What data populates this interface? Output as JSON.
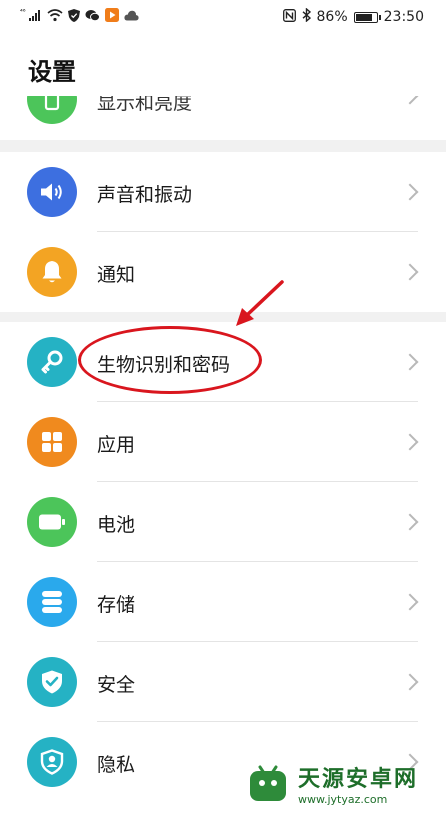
{
  "status_bar": {
    "signal_label": "⁴⁶",
    "battery_percent": "86%",
    "battery_level": 0.86,
    "time": "23:50"
  },
  "page": {
    "title": "设置"
  },
  "partial_item": {
    "label": "显示和亮度",
    "color": "#4cc55a"
  },
  "groups": [
    {
      "items": [
        {
          "label": "声音和振动",
          "icon": "speaker-icon",
          "color": "#3d6fe0"
        },
        {
          "label": "通知",
          "icon": "bell-icon",
          "color": "#f3a423"
        }
      ]
    },
    {
      "items": [
        {
          "label": "生物识别和密码",
          "icon": "key-icon",
          "color": "#25b2c4"
        },
        {
          "label": "应用",
          "icon": "grid-icon",
          "color": "#f08a1e"
        },
        {
          "label": "电池",
          "icon": "battery-icon",
          "color": "#4cc55a"
        },
        {
          "label": "存储",
          "icon": "storage-icon",
          "color": "#2aa9ec"
        },
        {
          "label": "安全",
          "icon": "shield-check-icon",
          "color": "#25b2c4"
        },
        {
          "label": "隐私",
          "icon": "privacy-shield-icon",
          "color": "#25b2c4"
        }
      ]
    }
  ],
  "annotation": {
    "color": "#d9161e"
  },
  "watermark": {
    "title": "天源安卓网",
    "url": "www.jytyaz.com"
  }
}
